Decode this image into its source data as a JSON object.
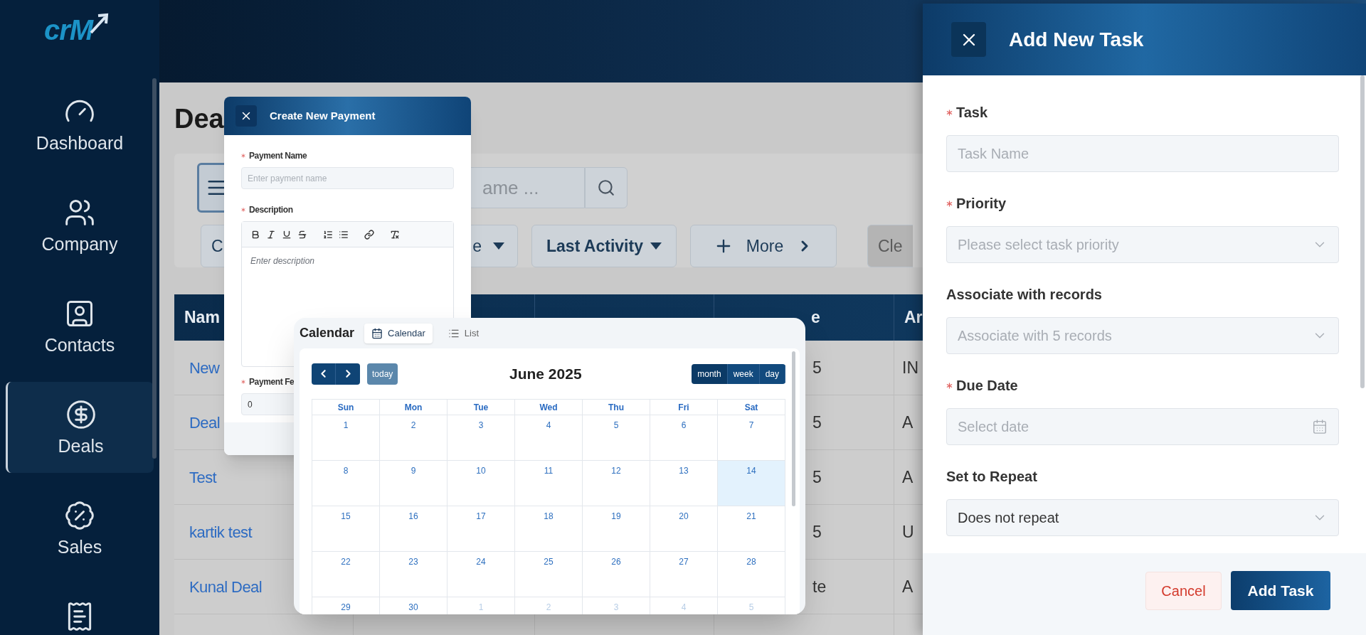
{
  "logo": "crM",
  "sidebar": {
    "items": [
      {
        "kind": "dashboard",
        "label": "Dashboard",
        "selected": false
      },
      {
        "kind": "company",
        "label": "Company",
        "selected": false
      },
      {
        "kind": "contacts",
        "label": "Contacts",
        "selected": false
      },
      {
        "kind": "deals",
        "label": "Deals",
        "selected": true
      },
      {
        "kind": "sales",
        "label": "Sales",
        "selected": false
      },
      {
        "kind": "invoice",
        "selected": false
      }
    ]
  },
  "page": {
    "title": "Dea",
    "search": {
      "placeholder": "ame ..."
    },
    "filters": [
      {
        "kind": "button",
        "label": "C"
      },
      {
        "kind": "dropdown",
        "label": "e"
      },
      {
        "kind": "dropdown",
        "label": "Last Activity"
      },
      {
        "kind": "more",
        "label": "More"
      },
      {
        "kind": "clear",
        "label": "Cle"
      }
    ],
    "table": {
      "columns": [
        "Nam",
        "",
        "",
        "e",
        "Ar"
      ],
      "rows": [
        {
          "name": "New",
          "column_4": "5",
          "column_5": "IN"
        },
        {
          "name": "Deal",
          "column_4": "5",
          "column_5": "A"
        },
        {
          "name": "Test",
          "column_4": "5",
          "column_5": "A"
        },
        {
          "name": "kartik test",
          "column_4": "5",
          "column_5": "U"
        },
        {
          "name": "Kunal Deal",
          "column_4": "te",
          "column_5": "A"
        }
      ]
    }
  },
  "payment_dialog": {
    "title": "Create New Payment",
    "fields": [
      {
        "kind": "text",
        "label": "Payment Name",
        "required": true,
        "placeholder": "Enter payment name"
      },
      {
        "kind": "rich",
        "label": "Description",
        "required": true,
        "placeholder": "Enter description"
      },
      {
        "kind": "text",
        "label": "Payment Fe",
        "required": true,
        "value": "0"
      }
    ]
  },
  "calendar": {
    "title": "Calendar",
    "views": [
      {
        "kind": "calendar",
        "label": "Calendar",
        "selected": true
      },
      {
        "kind": "list",
        "label": "List",
        "selected": false
      }
    ],
    "today": "today",
    "month_title": "June 2025",
    "modes": [
      {
        "label": "month",
        "selected": true
      },
      {
        "label": "week",
        "selected": false
      },
      {
        "label": "day",
        "selected": false
      }
    ],
    "weekdays": [
      "Sun",
      "Mon",
      "Tue",
      "Wed",
      "Thu",
      "Fri",
      "Sat"
    ],
    "weeks": [
      [
        {
          "day": "1",
          "other_month": false,
          "selected": false
        },
        {
          "day": "2",
          "other_month": false,
          "selected": false
        },
        {
          "day": "3",
          "other_month": false,
          "selected": false
        },
        {
          "day": "4",
          "other_month": false,
          "selected": false
        },
        {
          "day": "5",
          "other_month": false,
          "selected": false
        },
        {
          "day": "6",
          "other_month": false,
          "selected": false
        },
        {
          "day": "7",
          "other_month": false,
          "selected": false
        }
      ],
      [
        {
          "day": "8",
          "other_month": false,
          "selected": false
        },
        {
          "day": "9",
          "other_month": false,
          "selected": false
        },
        {
          "day": "10",
          "other_month": false,
          "selected": false
        },
        {
          "day": "11",
          "other_month": false,
          "selected": false
        },
        {
          "day": "12",
          "other_month": false,
          "selected": false
        },
        {
          "day": "13",
          "other_month": false,
          "selected": false
        },
        {
          "day": "14",
          "other_month": false,
          "selected": true
        }
      ],
      [
        {
          "day": "15",
          "other_month": false,
          "selected": false
        },
        {
          "day": "16",
          "other_month": false,
          "selected": false
        },
        {
          "day": "17",
          "other_month": false,
          "selected": false
        },
        {
          "day": "18",
          "other_month": false,
          "selected": false
        },
        {
          "day": "19",
          "other_month": false,
          "selected": false
        },
        {
          "day": "20",
          "other_month": false,
          "selected": false
        },
        {
          "day": "21",
          "other_month": false,
          "selected": false
        }
      ],
      [
        {
          "day": "22",
          "other_month": false,
          "selected": false
        },
        {
          "day": "23",
          "other_month": false,
          "selected": false
        },
        {
          "day": "24",
          "other_month": false,
          "selected": false
        },
        {
          "day": "25",
          "other_month": false,
          "selected": false
        },
        {
          "day": "26",
          "other_month": false,
          "selected": false
        },
        {
          "day": "27",
          "other_month": false,
          "selected": false
        },
        {
          "day": "28",
          "other_month": false,
          "selected": false
        }
      ],
      [
        {
          "day": "29",
          "other_month": false,
          "selected": false
        },
        {
          "day": "30",
          "other_month": false,
          "selected": false
        },
        {
          "day": "1",
          "other_month": true,
          "selected": false
        },
        {
          "day": "2",
          "other_month": true,
          "selected": false
        },
        {
          "day": "3",
          "other_month": true,
          "selected": false
        },
        {
          "day": "4",
          "other_month": true,
          "selected": false
        },
        {
          "day": "5",
          "other_month": true,
          "selected": false
        }
      ]
    ]
  },
  "task_panel": {
    "title": "Add New Task",
    "fields": [
      {
        "kind": "text",
        "label": "Task",
        "required": true,
        "placeholder": "Task Name"
      },
      {
        "kind": "select",
        "label": "Priority",
        "required": true,
        "placeholder": "Please select task priority"
      },
      {
        "kind": "select",
        "label": "Associate with records",
        "required": false,
        "placeholder": "Associate with 5 records"
      },
      {
        "kind": "date",
        "label": "Due Date",
        "required": true,
        "placeholder": "Select date"
      },
      {
        "kind": "select",
        "label": "Set to Repeat",
        "required": false,
        "value": "Does not repeat"
      }
    ],
    "buttons": [
      {
        "kind": "secondary",
        "label": "Cancel"
      },
      {
        "kind": "primary",
        "label": "Add Task"
      }
    ]
  }
}
